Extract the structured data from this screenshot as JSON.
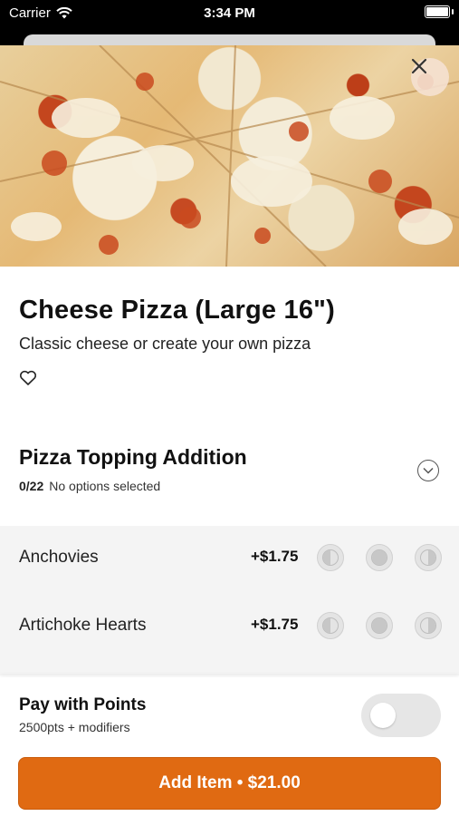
{
  "status_bar": {
    "carrier": "Carrier",
    "time": "3:34 PM"
  },
  "item": {
    "title": "Cheese Pizza (Large 16\")",
    "description": "Classic cheese or create your own pizza"
  },
  "topping_section": {
    "title": "Pizza Topping Addition",
    "count": "0/22",
    "status": "No options selected"
  },
  "options": [
    {
      "name": "Anchovies",
      "price": "+$1.75"
    },
    {
      "name": "Artichoke Hearts",
      "price": "+$1.75"
    }
  ],
  "points": {
    "title": "Pay with Points",
    "subtitle": "2500pts + modifiers",
    "enabled": false
  },
  "cta": {
    "label": "Add Item • $21.00"
  },
  "colors": {
    "accent": "#e06a12"
  },
  "icons": [
    "wifi-icon",
    "battery-icon",
    "close-icon",
    "heart-icon",
    "chevron-down-icon",
    "left-half-icon",
    "whole-icon",
    "right-half-icon"
  ]
}
